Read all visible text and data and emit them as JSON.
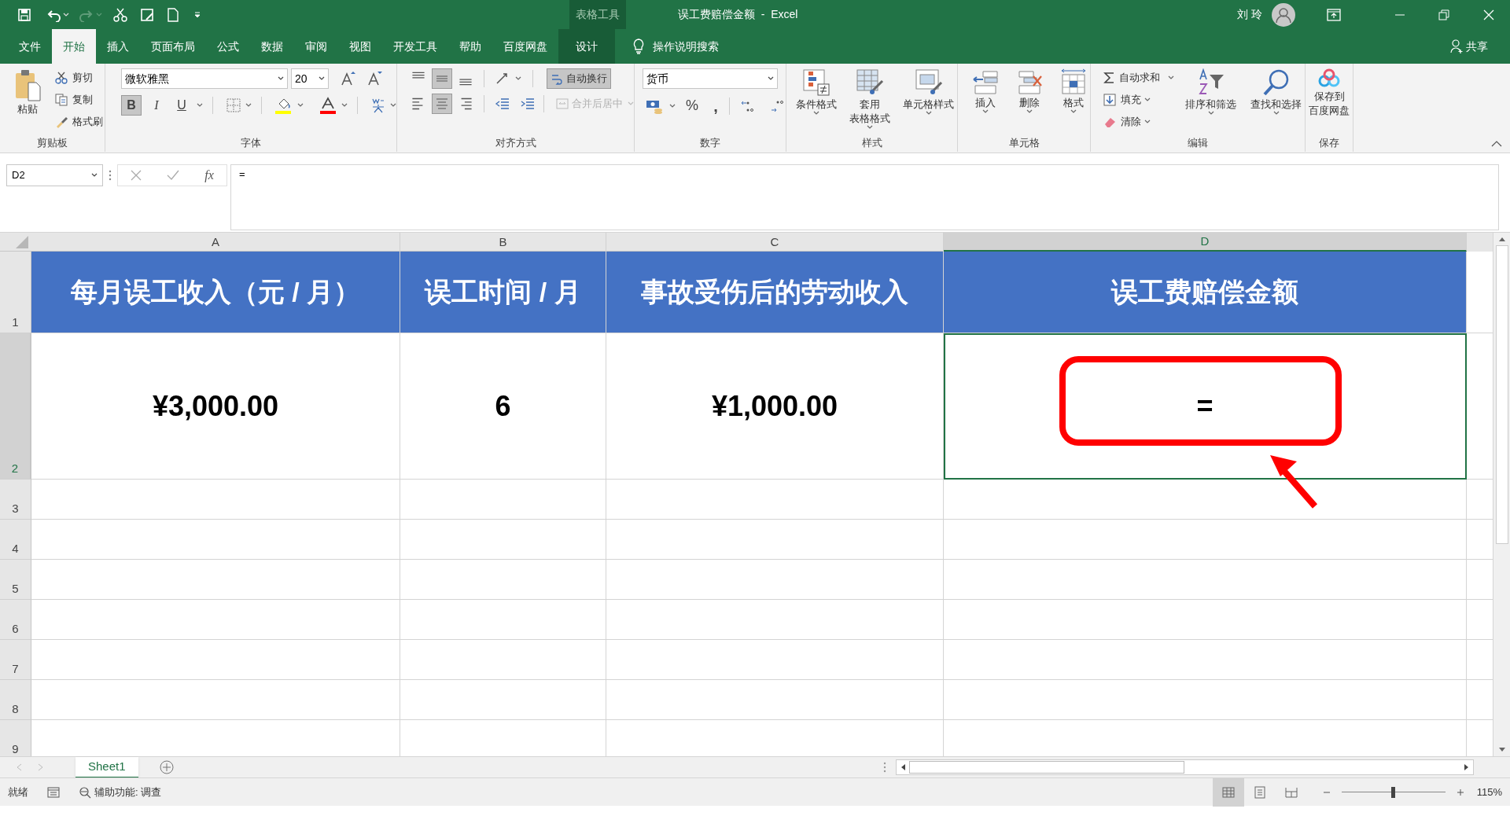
{
  "title_bar": {
    "context_label": "表格工具",
    "document_title": "误工费赔偿金额  -  Excel",
    "user_name": "刘 玲"
  },
  "tabs": [
    {
      "label": "文件",
      "selected": false,
      "contextual": false
    },
    {
      "label": "开始",
      "selected": true,
      "contextual": false
    },
    {
      "label": "插入",
      "selected": false,
      "contextual": false
    },
    {
      "label": "页面布局",
      "selected": false,
      "contextual": false
    },
    {
      "label": "公式",
      "selected": false,
      "contextual": false
    },
    {
      "label": "数据",
      "selected": false,
      "contextual": false
    },
    {
      "label": "审阅",
      "selected": false,
      "contextual": false
    },
    {
      "label": "视图",
      "selected": false,
      "contextual": false
    },
    {
      "label": "开发工具",
      "selected": false,
      "contextual": false
    },
    {
      "label": "帮助",
      "selected": false,
      "contextual": false
    },
    {
      "label": "百度网盘",
      "selected": false,
      "contextual": false
    },
    {
      "label": "设计",
      "selected": false,
      "contextual": true
    }
  ],
  "tell_me": "操作说明搜索",
  "share": "共享",
  "ribbon": {
    "clipboard": {
      "label": "剪贴板",
      "paste": "粘贴",
      "cut": "剪切",
      "copy": "复制",
      "format_painter": "格式刷"
    },
    "font": {
      "label": "字体",
      "font_name": "微软雅黑",
      "font_size": "20",
      "bold": {
        "text": "B",
        "on": true
      },
      "italic": {
        "text": "I",
        "on": false
      },
      "underline": {
        "text": "U",
        "on": false
      }
    },
    "alignment": {
      "label": "对齐方式",
      "wrap_text": {
        "text": "自动换行",
        "on": true
      },
      "merge_center": {
        "text": "合并后居中",
        "disabled": true
      },
      "vertical_align": [
        {
          "selected": false
        },
        {
          "selected": true
        },
        {
          "selected": false
        }
      ],
      "horizontal_align": [
        {
          "selected": false
        },
        {
          "selected": true
        },
        {
          "selected": false
        }
      ]
    },
    "number": {
      "label": "数字",
      "format": "货币",
      "percent": "%",
      "comma": ","
    },
    "styles": {
      "label": "样式",
      "buttons": [
        {
          "lines": [
            "条件格式"
          ]
        },
        {
          "lines": [
            "套用",
            "表格格式"
          ]
        },
        {
          "lines": [
            "单元格样式"
          ]
        }
      ]
    },
    "cells": {
      "label": "单元格",
      "buttons": [
        "插入",
        "删除",
        "格式"
      ]
    },
    "editing": {
      "label": "编辑",
      "autosum": "自动求和",
      "fill": "填充",
      "clear": "清除",
      "sort_filter": "排序和筛选",
      "find_select": "查找和选择"
    },
    "save": {
      "label": "保存",
      "button": {
        "lines": [
          "保存到",
          "百度网盘"
        ]
      }
    }
  },
  "formula_bar": {
    "name_box": "D2",
    "fx": "fx",
    "formula": "="
  },
  "sheet": {
    "columns": [
      {
        "label": "A",
        "selected": false
      },
      {
        "label": "B",
        "selected": false
      },
      {
        "label": "C",
        "selected": false
      },
      {
        "label": "D",
        "selected": true
      }
    ],
    "rows": [
      {
        "label": "1",
        "selected": false
      },
      {
        "label": "2",
        "selected": true
      },
      {
        "label": "3",
        "selected": false
      },
      {
        "label": "4",
        "selected": false
      },
      {
        "label": "5",
        "selected": false
      },
      {
        "label": "6",
        "selected": false
      },
      {
        "label": "7",
        "selected": false
      },
      {
        "label": "8",
        "selected": false
      },
      {
        "label": "9",
        "selected": false
      }
    ],
    "table_rows": [
      {
        "kind": "header",
        "cells": [
          {
            "text": "每月误工收入（元 / 月）",
            "active": false
          },
          {
            "text": "误工时间 / 月",
            "active": false
          },
          {
            "text": "事故受伤后的劳动收入",
            "active": false
          },
          {
            "text": "误工费赔偿金额",
            "active": false
          }
        ]
      },
      {
        "kind": "data",
        "cells": [
          {
            "text": "¥3,000.00",
            "active": false
          },
          {
            "text": "6",
            "active": false
          },
          {
            "text": "¥1,000.00",
            "active": false
          },
          {
            "text": "=",
            "active": true
          }
        ]
      }
    ]
  },
  "annotation": {
    "highlight_box": true,
    "arrow": true
  },
  "sheet_tabs": [
    {
      "label": "Sheet1",
      "selected": true
    }
  ],
  "status_bar": {
    "mode": "就绪",
    "accessibility": "辅助功能: 调查",
    "views": [
      {
        "selected": true
      },
      {
        "selected": false
      },
      {
        "selected": false
      }
    ],
    "zoom": {
      "level": 0.5
    },
    "zoom_label": "115%"
  }
}
